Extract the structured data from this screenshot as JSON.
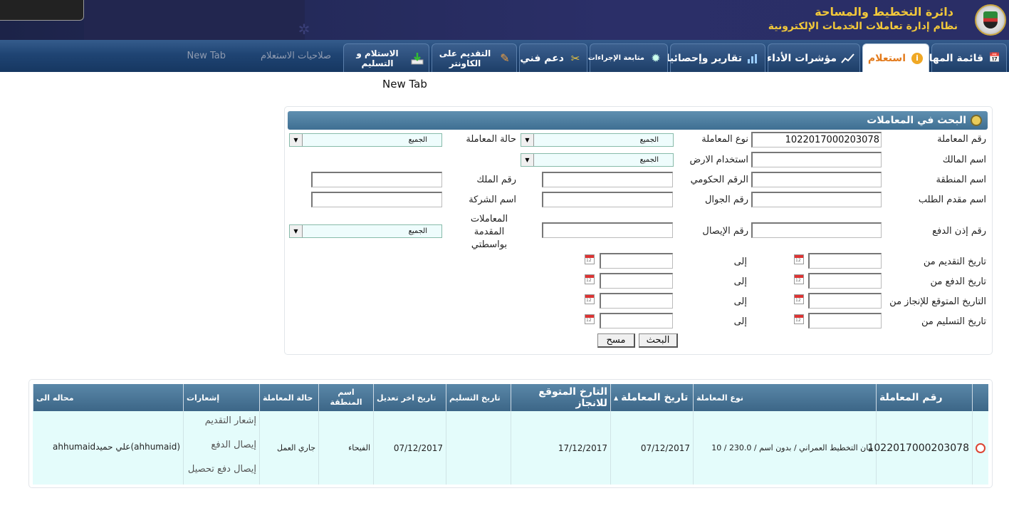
{
  "header": {
    "title": "دائرة التخطيط والمساحة",
    "subtitle": "نظام إدارة تعاملات الخدمات الإلكترونية"
  },
  "nav": {
    "tabs": [
      {
        "label": "قائمة المهام",
        "icon": "calendar-icon"
      },
      {
        "label": "استعلام",
        "icon": "info-icon",
        "active": true
      },
      {
        "label": "مؤشرات الأداء",
        "icon": "chart-line-icon"
      },
      {
        "label": "تقارير وإحصائيات",
        "icon": "bar-chart-icon"
      },
      {
        "label": "متابعة الإجراءات",
        "icon": "gear-icon"
      },
      {
        "label": "دعم فني",
        "icon": "tools-icon"
      },
      {
        "label": "التقديم على الكاونتر",
        "icon": "pen-icon"
      },
      {
        "label": "الاستلام و التسليم",
        "icon": "download-icon"
      }
    ],
    "ghost_tabs": [
      "صلاحيات الاستعلام",
      "New Tab"
    ]
  },
  "page_tab_title": "New Tab",
  "search": {
    "title": "البحث في المعاملات",
    "labels": {
      "trans_no": "رقم المعاملة",
      "trans_type": "نوع المعاملة",
      "trans_status": "حالة المعاملة",
      "owner_name": "اسم المالك",
      "land_use": "استخدام الارض",
      "area_name": "اسم المنطقة",
      "gov_no": "الرقم الحكومي",
      "property_no": "رقم الملك",
      "applicant_name": "اسم مقدم الطلب",
      "mobile_no": "رقم الجوال",
      "company_name": "اسم الشركة",
      "payment_permit_no": "رقم إذن الدفع",
      "receipt_no": "رقم الإيصال",
      "submitted_by_me": "المعاملات المقدمة بواسطتي",
      "submit_date_from": "تاريخ التقديم من",
      "payment_date_from": "تاريخ الدفع من",
      "expected_date_from": "التاريخ المتوقع للإنجاز من",
      "delivery_date_from": "تاريخ التسليم من",
      "to": "إلى"
    },
    "values": {
      "trans_no": "1022017000203078",
      "trans_type": "الجميع",
      "trans_status": "الجميع",
      "land_use": "الجميع",
      "submitted_by_me": "الجميع"
    },
    "buttons": {
      "search": "البحث",
      "clear": "مسح"
    }
  },
  "results": {
    "columns": [
      "رقم المعاملة",
      "نوع المعاملة",
      "تاريخ المعاملة",
      "التارخ المتوقع للانجاز",
      "تاريخ التسليم",
      "تاريخ اخر تعديل",
      "اسم المنطقة",
      "حالة المعاملة",
      "إشعارات",
      "محاله الى"
    ],
    "rows": [
      {
        "trans_no": "1022017000203078",
        "trans_type": "بيان التخطيط العمراني / بدون اسم / 230.0 / 10",
        "trans_date": "07/12/2017",
        "expected_date": "17/12/2017",
        "delivery_date": "",
        "last_modified": "07/12/2017",
        "area": "الفيحاء",
        "status": "جاري العمل",
        "notifications": [
          "إشعار التقديم",
          "إيصال الدفع",
          "إيصال دفع تحصيل"
        ],
        "assigned_user": "(ahhumaid)علي حميد",
        "assigned_id": "ahhumaid"
      }
    ]
  }
}
